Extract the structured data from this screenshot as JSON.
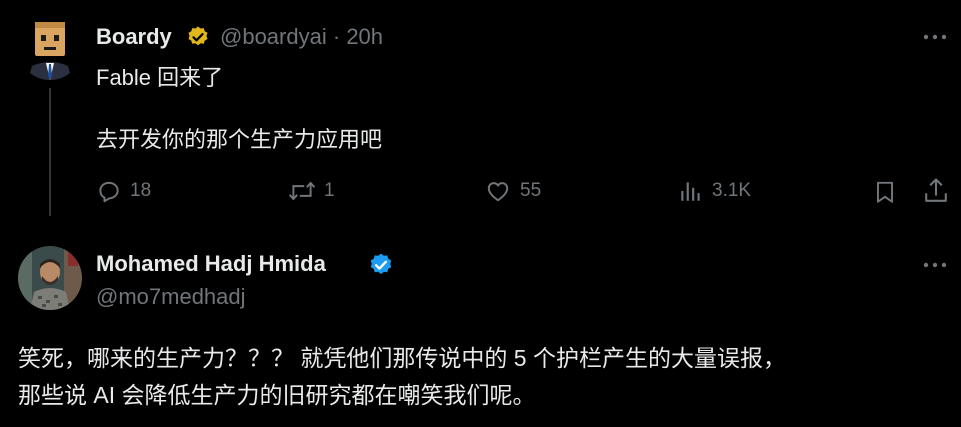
{
  "tweet1": {
    "display_name": "Boardy",
    "handle": "@boardyai",
    "separator": "·",
    "time": "20h",
    "lines": [
      "Fable 回来了",
      "去开发你的那个生产力应用吧"
    ],
    "stats": {
      "replies": "18",
      "retweets": "1",
      "likes": "55",
      "views": "3.1K"
    },
    "badge_color": "#e2b719"
  },
  "tweet2": {
    "display_name": "Mohamed Hadj Hmida",
    "handle": "@mo7medhadj",
    "lines": [
      "笑死，哪来的生产力？？？ 就凭他们那传说中的 5 个护栏产生的大量误报，",
      "那些说 AI 会降低生产力的旧研究都在嘲笑我们呢。"
    ],
    "badge_color": "#1d9bf0"
  },
  "icons": {
    "reply": "reply-icon",
    "retweet": "retweet-icon",
    "like": "heart-icon",
    "views": "views-icon",
    "bookmark": "bookmark-icon",
    "share": "share-icon",
    "more": "more-icon"
  },
  "colors": {
    "background": "#000000",
    "text": "#e7e9ea",
    "muted": "#71767b",
    "thread_line": "#333639"
  }
}
